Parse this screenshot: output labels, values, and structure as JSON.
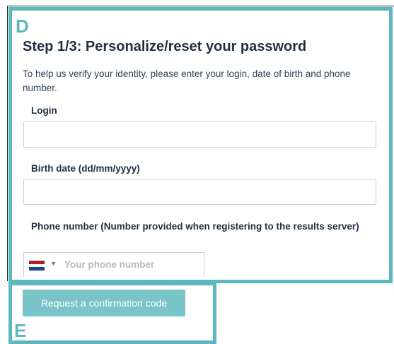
{
  "annotations": {
    "section_d": "D",
    "section_e": "E"
  },
  "form": {
    "title": "Step 1/3: Personalize/reset your password",
    "intro": "To help us verify your identity, please enter your login, date of birth and phone number.",
    "login_label": "Login",
    "login_value": "",
    "birth_label": "Birth date (dd/mm/yyyy)",
    "birth_value": "",
    "phone_label": "Phone number (Number provided when registering to the results server)",
    "phone_placeholder": "Your phone number",
    "flag_icon": "netherlands-flag-icon",
    "flag_colors": [
      "#ae1c28",
      "#ffffff",
      "#21468b"
    ]
  },
  "actions": {
    "request_code_label": "Request a confirmation code"
  },
  "colors": {
    "annotation": "#5ab8be",
    "button": "#79c4c9",
    "heading": "#1d3045"
  }
}
